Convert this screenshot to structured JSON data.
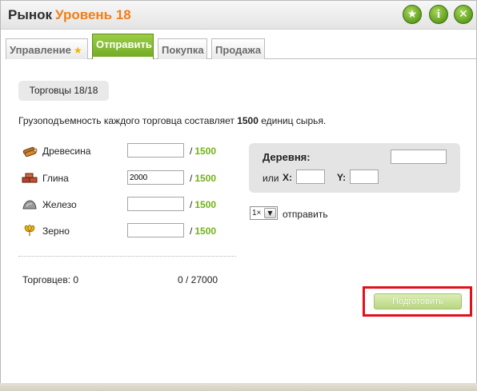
{
  "window": {
    "title": "Рынок",
    "level": "Уровень 18",
    "buttons": {
      "star_icon": "star-icon",
      "info_icon": "info-icon",
      "close_icon": "close-icon"
    }
  },
  "tabs": [
    {
      "label": "Управление",
      "active": false,
      "has_star": true
    },
    {
      "label": "Отправить",
      "active": true
    },
    {
      "label": "Покупка",
      "active": false
    },
    {
      "label": "Продажа",
      "active": false
    }
  ],
  "merchants": {
    "label": "Торговцы 18/18"
  },
  "capacity": {
    "prefix": "Грузоподъемность каждого торговца составляет",
    "amount": "1500",
    "suffix": "единиц сырья."
  },
  "resources": [
    {
      "name": "Древесина",
      "icon": "wood-icon",
      "value": "",
      "max_sep": "/",
      "max": "1500"
    },
    {
      "name": "Глина",
      "icon": "clay-icon",
      "value": "2000",
      "max_sep": "/",
      "max": "1500"
    },
    {
      "name": "Железо",
      "icon": "iron-icon",
      "value": "",
      "max_sep": "/",
      "max": "1500"
    },
    {
      "name": "Зерно",
      "icon": "crop-icon",
      "value": "",
      "max_sep": "/",
      "max": "1500"
    }
  ],
  "summary": {
    "merchants_label": "Торговцев: 0",
    "load_total": "0  / 27000"
  },
  "destination": {
    "village_label": "Деревня:",
    "village_value": "",
    "or_label": "или",
    "x_label": "X:",
    "x_value": "",
    "y_label": "Y:",
    "y_value": ""
  },
  "send": {
    "times_value": "1×",
    "label": "отправить"
  },
  "prepare_button": {
    "label": "Подготовить"
  },
  "colors": {
    "accent_green": "#71b21a",
    "title_orange": "#f07f17",
    "highlight_red": "#e2101d"
  }
}
